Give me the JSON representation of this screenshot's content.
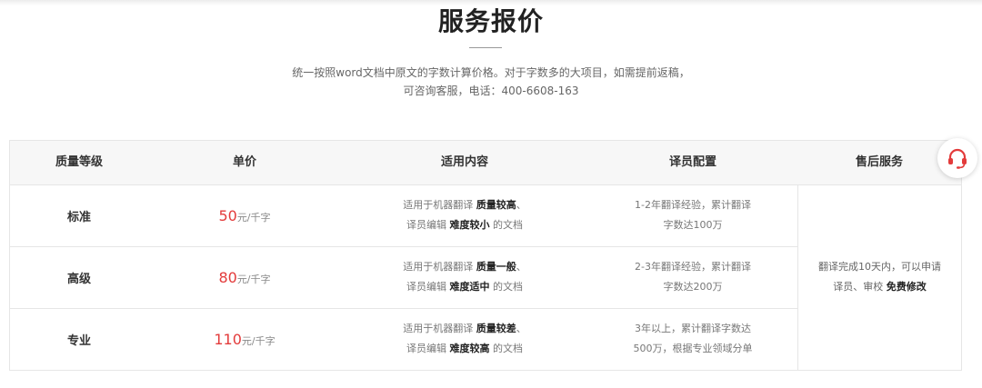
{
  "header": {
    "title": "服务报价",
    "subtitle_line1": "统一按照word文档中原文的字数计算价格。对于字数多的大项目，如需提前返稿，",
    "subtitle_line2": "可咨询客服，电话：400-6608-163"
  },
  "table": {
    "columns": [
      "质量等级",
      "单价",
      "适用内容",
      "译员配置",
      "售后服务"
    ],
    "rows": [
      {
        "grade": "标准",
        "price": "50",
        "unit": "元/千字",
        "scope_line1_prefix": "适用于机器翻译 ",
        "scope_line1_bold": "质量较高",
        "scope_line1_suffix": "、",
        "scope_line2_prefix": "译员编辑 ",
        "scope_line2_bold": "难度较小",
        "scope_line2_suffix": " 的文档",
        "staff_line1": "1-2年翻译经验，累计翻译",
        "staff_line2": "字数达100万"
      },
      {
        "grade": "高级",
        "price": "80",
        "unit": "元/千字",
        "scope_line1_prefix": "适用于机器翻译 ",
        "scope_line1_bold": "质量一般",
        "scope_line1_suffix": "、",
        "scope_line2_prefix": "译员编辑 ",
        "scope_line2_bold": "难度适中",
        "scope_line2_suffix": " 的文档",
        "staff_line1": "2-3年翻译经验，累计翻译",
        "staff_line2": "字数达200万"
      },
      {
        "grade": "专业",
        "price": "110",
        "unit": "元/千字",
        "scope_line1_prefix": "适用于机器翻译 ",
        "scope_line1_bold": "质量较差",
        "scope_line1_suffix": "、",
        "scope_line2_prefix": "译员编辑 ",
        "scope_line2_bold": "难度较高",
        "scope_line2_suffix": " 的文档",
        "staff_line1": "3年以上，累计翻译字数达",
        "staff_line2": "500万，根据专业领域分单"
      }
    ],
    "aftersale_line1": "翻译完成10天内，可以申请",
    "aftersale_line2_prefix": "译员、审校 ",
    "aftersale_line2_bold": "免费修改"
  },
  "support_button": {
    "icon": "headset-icon",
    "color": "#e33b3b"
  },
  "colors": {
    "price": "#e33b3b",
    "header_bg": "#f7f7f7",
    "border": "#e6e6e6"
  }
}
